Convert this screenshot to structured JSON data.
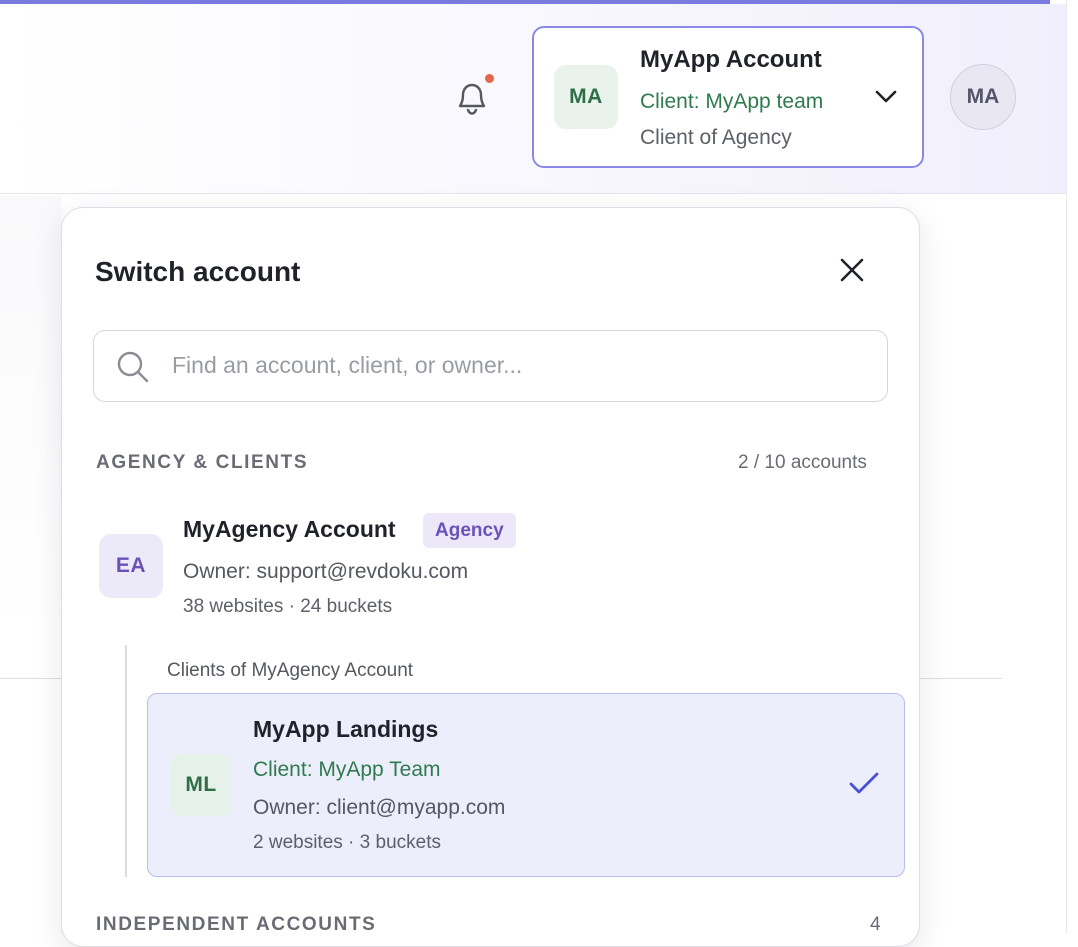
{
  "header": {
    "notification_icon": "bell-icon",
    "has_unread_notifications": true,
    "account_switcher": {
      "avatar_initials": "MA",
      "title": "MyApp Account",
      "client_line": "Client: MyApp team",
      "subtitle": "Client of Agency",
      "chevron_icon": "chevron-down-icon"
    },
    "user_avatar_initials": "MA"
  },
  "switch_panel": {
    "title": "Switch account",
    "close_icon": "close-icon",
    "search": {
      "placeholder": "Find an account, client, or owner...",
      "value": ""
    },
    "agency_section": {
      "label": "AGENCY & CLIENTS",
      "count": "2 / 10 accounts",
      "agency": {
        "avatar_initials": "EA",
        "name": "MyAgency Account",
        "badge": "Agency",
        "owner": "Owner: support@revdoku.com",
        "meta": "38 websites · 24 buckets"
      },
      "clients_label": "Clients of MyAgency Account",
      "clients": [
        {
          "avatar_initials": "ML",
          "name": "MyApp Landings",
          "client_line": "Client: MyApp Team",
          "owner": "Owner: client@myapp.com",
          "meta": "2 websites · 3 buckets",
          "selected": true
        }
      ]
    },
    "independent_section": {
      "label": "INDEPENDENT ACCOUNTS",
      "count": "4"
    }
  },
  "colors": {
    "accent": "#7b7bdf",
    "client_green": "#2f7a4f",
    "agency_purple": "#6b52b6",
    "selected_bg": "#eceefb",
    "notification_dot": "#e2674e"
  }
}
